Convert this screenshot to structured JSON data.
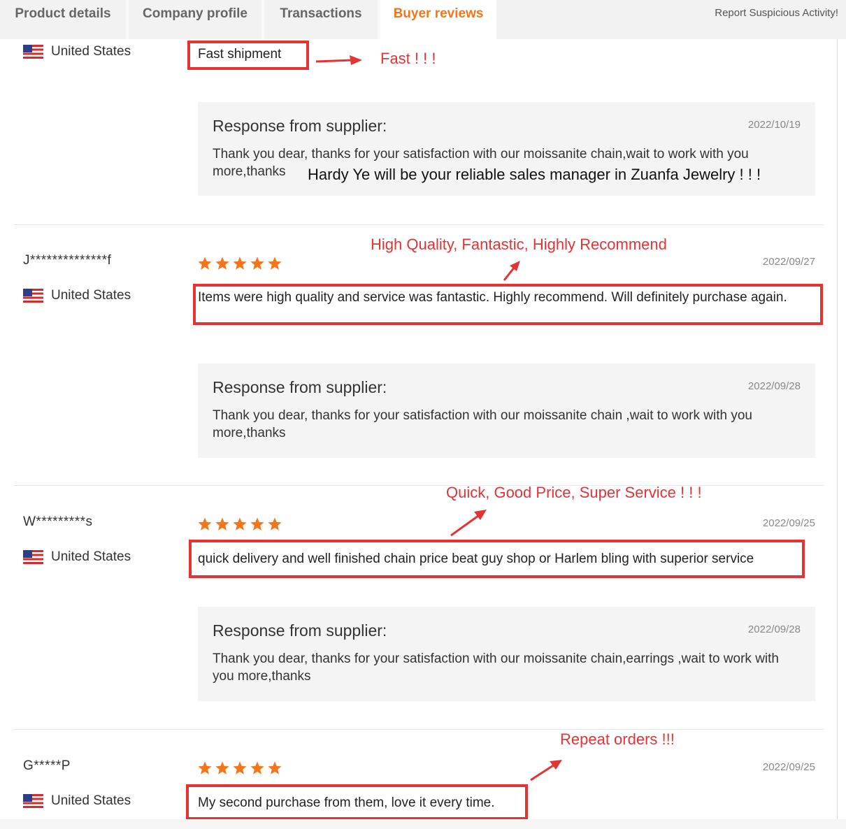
{
  "tabs": [
    {
      "label": "Product details",
      "active": false
    },
    {
      "label": "Company profile",
      "active": false
    },
    {
      "label": "Transactions",
      "active": false
    },
    {
      "label": "Buyer reviews",
      "active": true
    }
  ],
  "report_link": "Report Suspicious Activity!",
  "colors": {
    "accent": "#f5761a",
    "annotation": "#e53334",
    "star": "#f5761a"
  },
  "reviews": [
    {
      "buyer": "",
      "country": "United States",
      "rating": null,
      "date": "",
      "text": "Fast shipment",
      "annotation": "Fast ! ! !",
      "response": {
        "title": "Response from supplier:",
        "date": "2022/10/19",
        "text": "Thank you dear, thanks for your satisfaction with our moissanite chain,wait to work with you more,thanks",
        "annotation": "Hardy Ye will be your reliable sales manager in Zuanfa Jewelry ! ! !"
      }
    },
    {
      "buyer": "J**************f",
      "country": "United States",
      "rating": 5,
      "date": "2022/09/27",
      "text": "Items were high quality and service was fantastic. Highly recommend. Will definitely purchase again.",
      "annotation": "High Quality, Fantastic, Highly Recommend",
      "response": {
        "title": "Response from supplier:",
        "date": "2022/09/28",
        "text": "Thank you dear, thanks for your satisfaction with our moissanite chain ,wait to work with you more,thanks"
      }
    },
    {
      "buyer": "W*********s",
      "country": "United States",
      "rating": 5,
      "date": "2022/09/25",
      "text": "quick delivery and well finished chain price beat guy shop or Harlem bling with superior service",
      "annotation": "Quick, Good Price, Super Service ! ! !",
      "response": {
        "title": "Response from supplier:",
        "date": "2022/09/28",
        "text": "Thank you dear, thanks for your satisfaction with our moissanite chain,earrings ,wait to work with you more,thanks"
      }
    },
    {
      "buyer": "G*****P",
      "country": "United States",
      "rating": 5,
      "date": "2022/09/25",
      "text": "My second purchase from them, love it every time.",
      "annotation": "Repeat orders !!!"
    }
  ],
  "icons": {
    "flag": "us-flag-icon",
    "star": "star-icon",
    "arrow": "arrow-icon"
  }
}
